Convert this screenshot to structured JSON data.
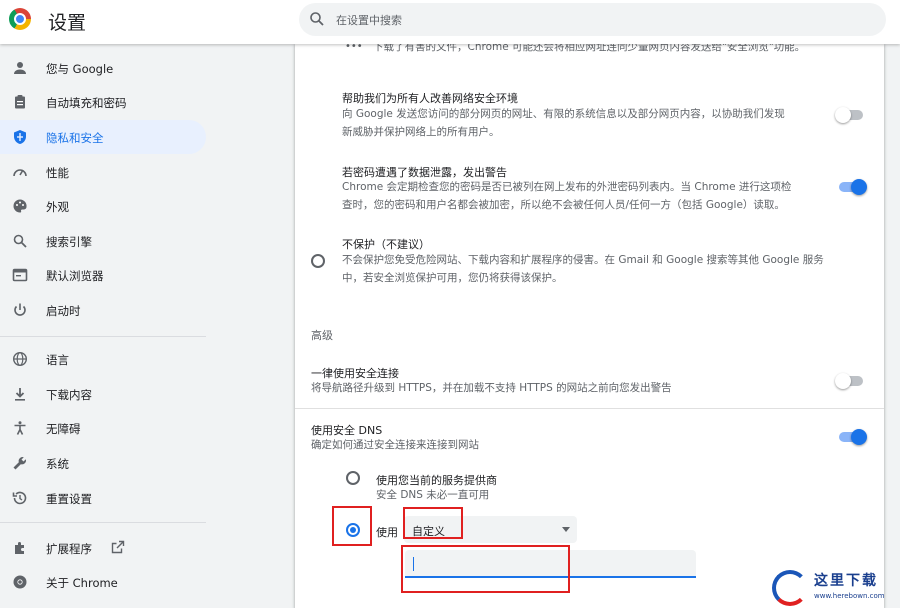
{
  "app": {
    "title": "设置",
    "search_placeholder": "在设置中搜索"
  },
  "sidebar": {
    "items": [
      {
        "label": "您与 Google",
        "icon": "person-icon"
      },
      {
        "label": "自动填充和密码",
        "icon": "clipboard-icon"
      },
      {
        "label": "隐私和安全",
        "icon": "shield-icon",
        "active": true
      },
      {
        "label": "性能",
        "icon": "speedometer-icon"
      },
      {
        "label": "外观",
        "icon": "palette-icon"
      },
      {
        "label": "搜索引擎",
        "icon": "search-icon"
      },
      {
        "label": "默认浏览器",
        "icon": "browser-icon"
      },
      {
        "label": "启动时",
        "icon": "power-icon"
      },
      {
        "label": "语言",
        "icon": "globe-icon"
      },
      {
        "label": "下载内容",
        "icon": "download-icon"
      },
      {
        "label": "无障碍",
        "icon": "accessibility-icon"
      },
      {
        "label": "系统",
        "icon": "wrench-icon"
      },
      {
        "label": "重置设置",
        "icon": "history-icon"
      },
      {
        "label": "扩展程序",
        "icon": "puzzle-icon"
      },
      {
        "label": "关于 Chrome",
        "icon": "chrome-icon"
      }
    ]
  },
  "main": {
    "top_partial_text": "下载了有害的文件，Chrome 可能还会将相应网址连同少量网页内容发送给\"安全浏览\"功能。",
    "help_improve": {
      "title": "帮助我们为所有人改善网络安全环境",
      "desc_line1": "向 Google 发送您访问的部分网页的网址、有限的系统信息以及部分网页内容，以协助我们发现",
      "desc_line2": "新威胁并保护网络上的所有用户。",
      "enabled": false
    },
    "password_leak": {
      "title": "若密码遭遇了数据泄露，发出警告",
      "desc_line1": "Chrome 会定期检查您的密码是否已被列在网上发布的外泄密码列表内。当 Chrome 进行这项检",
      "desc_line2": "查时，您的密码和用户名都会被加密，所以绝不会被任何人员/任何一方（包括 Google）读取。",
      "enabled": true
    },
    "no_protection": {
      "title": "不保护（不建议）",
      "desc_line1": "不会保护您免受危险网站、下载内容和扩展程序的侵害。在 Gmail 和 Google 搜索等其他 Google 服务",
      "desc_line2": "中，若安全浏览保护可用，您仍将获得该保护。",
      "selected": false
    },
    "advanced_heading": "高级",
    "always_secure": {
      "title": "一律使用安全连接",
      "desc": "将导航路径升级到 HTTPS，并在加载不支持 HTTPS 的网站之前向您发出警告",
      "enabled": false
    },
    "secure_dns": {
      "title": "使用安全 DNS",
      "desc": "确定如何通过安全连接来连接到网站",
      "enabled": true,
      "option_current": {
        "title": "使用您当前的服务提供商",
        "desc": "安全 DNS 未必一直可用",
        "selected": false
      },
      "option_custom": {
        "label": "使用",
        "provider_value": "自定义",
        "selected": true
      },
      "custom_input_value": ""
    }
  },
  "watermark": {
    "brand_text": "这里下载",
    "url_text": "www.herebown.com"
  },
  "colors": {
    "accent": "#1a73e8",
    "annotation": "#e02020"
  }
}
